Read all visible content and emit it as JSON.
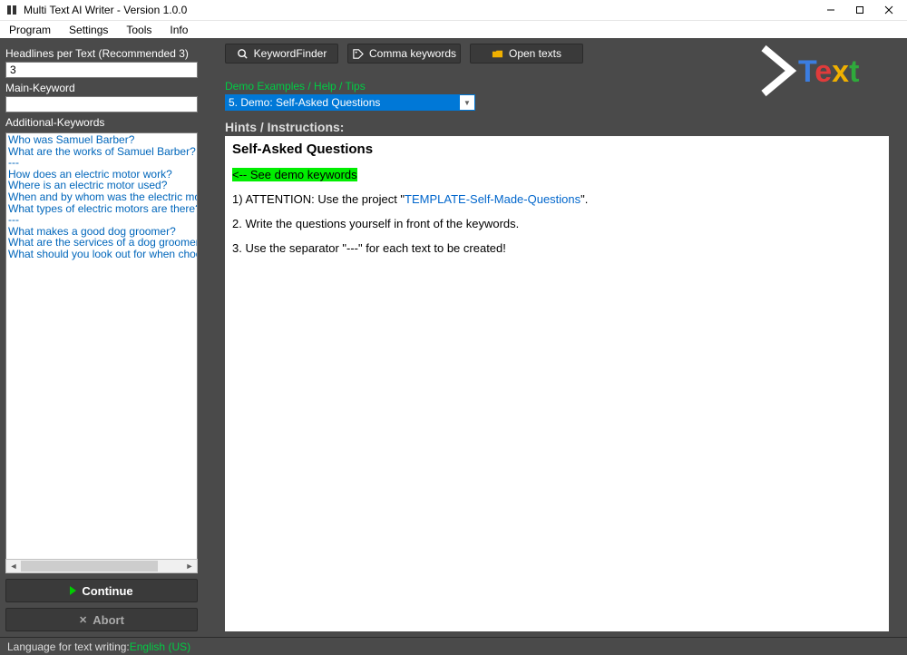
{
  "window": {
    "title": "Multi Text AI Writer - Version 1.0.0"
  },
  "menu": {
    "items": [
      "Program",
      "Settings",
      "Tools",
      "Info"
    ]
  },
  "left": {
    "headlines_label": "Headlines per Text (Recommended 3)",
    "headlines_value": "3",
    "main_keyword_label": "Main-Keyword",
    "main_keyword_value": "",
    "additional_label": "Additional-Keywords",
    "keywords": [
      "Who was Samuel Barber?",
      "What are the works of Samuel Barber?",
      "---",
      "How does an electric motor work?",
      "Where is an electric motor used?",
      "When and by whom was the electric motor invented?",
      "What types of electric motors are there?",
      "---",
      "What makes a good dog groomer?",
      "What are the services of a dog groomer?",
      "What should you look out for when choosing"
    ],
    "continue_label": "Continue",
    "abort_label": "Abort"
  },
  "toolbar": {
    "keyword_finder": "KeywordFinder",
    "comma_keywords": "Comma keywords",
    "open_texts": "Open texts"
  },
  "demo": {
    "label": "Demo Examples / Help / Tips",
    "selected": "5. Demo: Self-Asked Questions"
  },
  "hints": {
    "label": "Hints / Instructions:",
    "title": "Self-Asked Questions",
    "see_demo": "<-- See demo keywords",
    "line1_a": "1) ATTENTION: Use the project \"",
    "line1_link": "TEMPLATE-Self-Made-Questions",
    "line1_b": "\".",
    "line2": "2. Write the questions yourself in front of the keywords.",
    "line3": "3. Use the separator \"---\" for each text to be created!"
  },
  "status": {
    "prefix": "Language for text writing: ",
    "lang": "English (US)"
  }
}
